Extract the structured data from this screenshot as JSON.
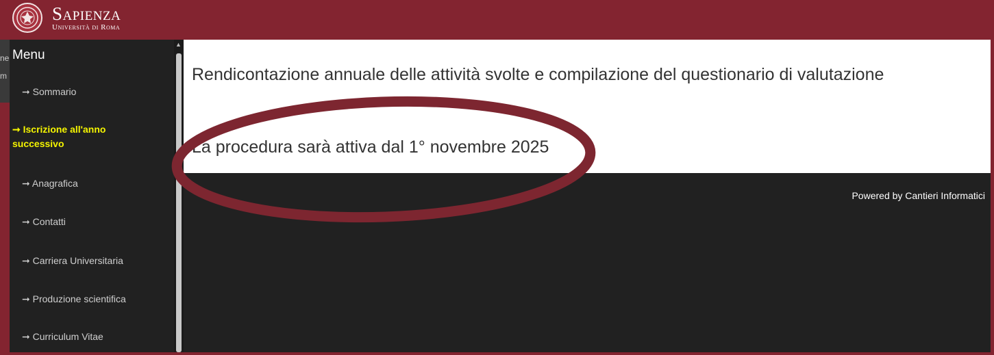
{
  "header": {
    "brand_name": "Sapienza",
    "brand_sub": "Università di Roma"
  },
  "sidebar": {
    "title": "Menu",
    "items": [
      {
        "label": "Sommario"
      },
      {
        "label": "Iscrizione all'anno successivo",
        "active": true
      },
      {
        "label": "Anagrafica"
      },
      {
        "label": "Contatti"
      },
      {
        "label": "Carriera Universitaria"
      },
      {
        "label": "Produzione scientifica"
      },
      {
        "label": "Curriculum Vitae"
      }
    ]
  },
  "main": {
    "heading": "Rendicontazione annuale delle attività svolte e compilazione del questionario di valutazione",
    "notice": "La procedura sarà attiva dal 1° novembre 2025"
  },
  "footer": {
    "powered_by": "Powered by Cantieri Informatici"
  },
  "colors": {
    "brand": "#832430",
    "sidebar_bg": "#212121",
    "active_item": "#f5f500",
    "highlight_oval": "#7d2630"
  },
  "arrow_glyph": "➞"
}
